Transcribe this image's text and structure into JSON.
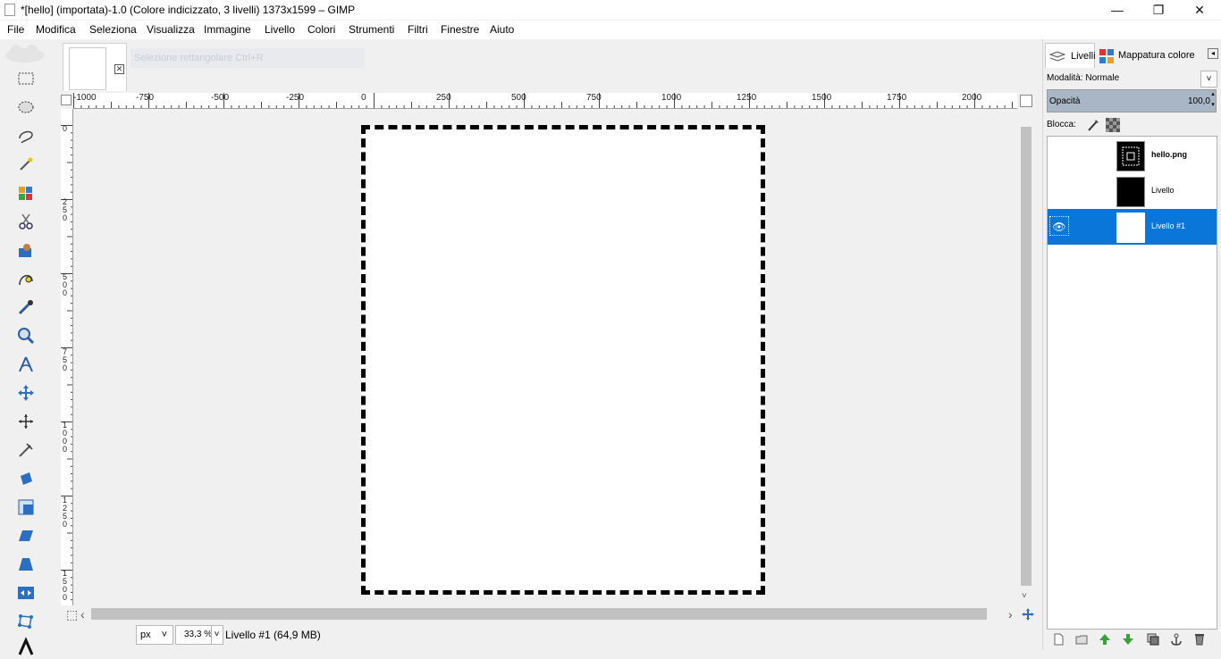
{
  "window": {
    "title": "*[hello] (importata)-1.0 (Colore indicizzato, 3 livelli) 1373x1599 – GIMP",
    "minimize": "—",
    "restore": "❐",
    "close": "✕"
  },
  "menu": [
    "File",
    "Modifica",
    "Seleziona",
    "Visualizza",
    "Immagine",
    "Livello",
    "Colori",
    "Strumenti",
    "Filtri",
    "Finestre",
    "Aiuto"
  ],
  "tools": [
    "rect-select-icon",
    "ellipse-select-icon",
    "free-select-icon",
    "fuzzy-select-icon",
    "select-by-color-icon",
    "scissors-icon",
    "foreground-select-icon",
    "paths-icon",
    "color-picker-icon",
    "zoom-icon",
    "measure-icon",
    "move-icon",
    "align-icon",
    "crop-icon",
    "rotate-icon",
    "scale-icon",
    "shear-icon",
    "perspective-icon",
    "flip-icon",
    "cage-icon",
    "text-icon"
  ],
  "image_tab": {
    "close_label": "✕",
    "ghost_text": "Selezione rettangolare      Ctrl+R"
  },
  "rulers": {
    "h_labels": [
      "-1000",
      "-750",
      "-500",
      "-250",
      "0",
      "250",
      "500",
      "750",
      "1000",
      "1250",
      "1500",
      "1750",
      "2000"
    ],
    "v_labels": [
      "0",
      "250",
      "500",
      "750",
      "1000",
      "1250",
      "1500"
    ]
  },
  "scroll": {
    "left": "‹",
    "right": "›",
    "down": "˅"
  },
  "status": {
    "unit": "px",
    "zoom": "33,3 %",
    "message": "Livello #1 (64,9 MB)"
  },
  "dock": {
    "tab_layers": "Livelli",
    "tab_colormap": "Mappatura colore",
    "mode_label": "Modalità: Normale",
    "opacity_label": "Opacità",
    "opacity_value": "100,0",
    "lock_label": "Blocca:",
    "layers": [
      {
        "name": "hello.png",
        "bold": true,
        "visible": false,
        "selected": false
      },
      {
        "name": "Livello",
        "bold": false,
        "visible": false,
        "selected": false
      },
      {
        "name": "Livello #1",
        "bold": false,
        "visible": true,
        "selected": true
      }
    ],
    "footer_icons": [
      "new-layer-icon",
      "new-group-icon",
      "raise-layer-icon",
      "lower-layer-icon",
      "duplicate-layer-icon",
      "anchor-layer-icon",
      "delete-layer-icon"
    ]
  }
}
